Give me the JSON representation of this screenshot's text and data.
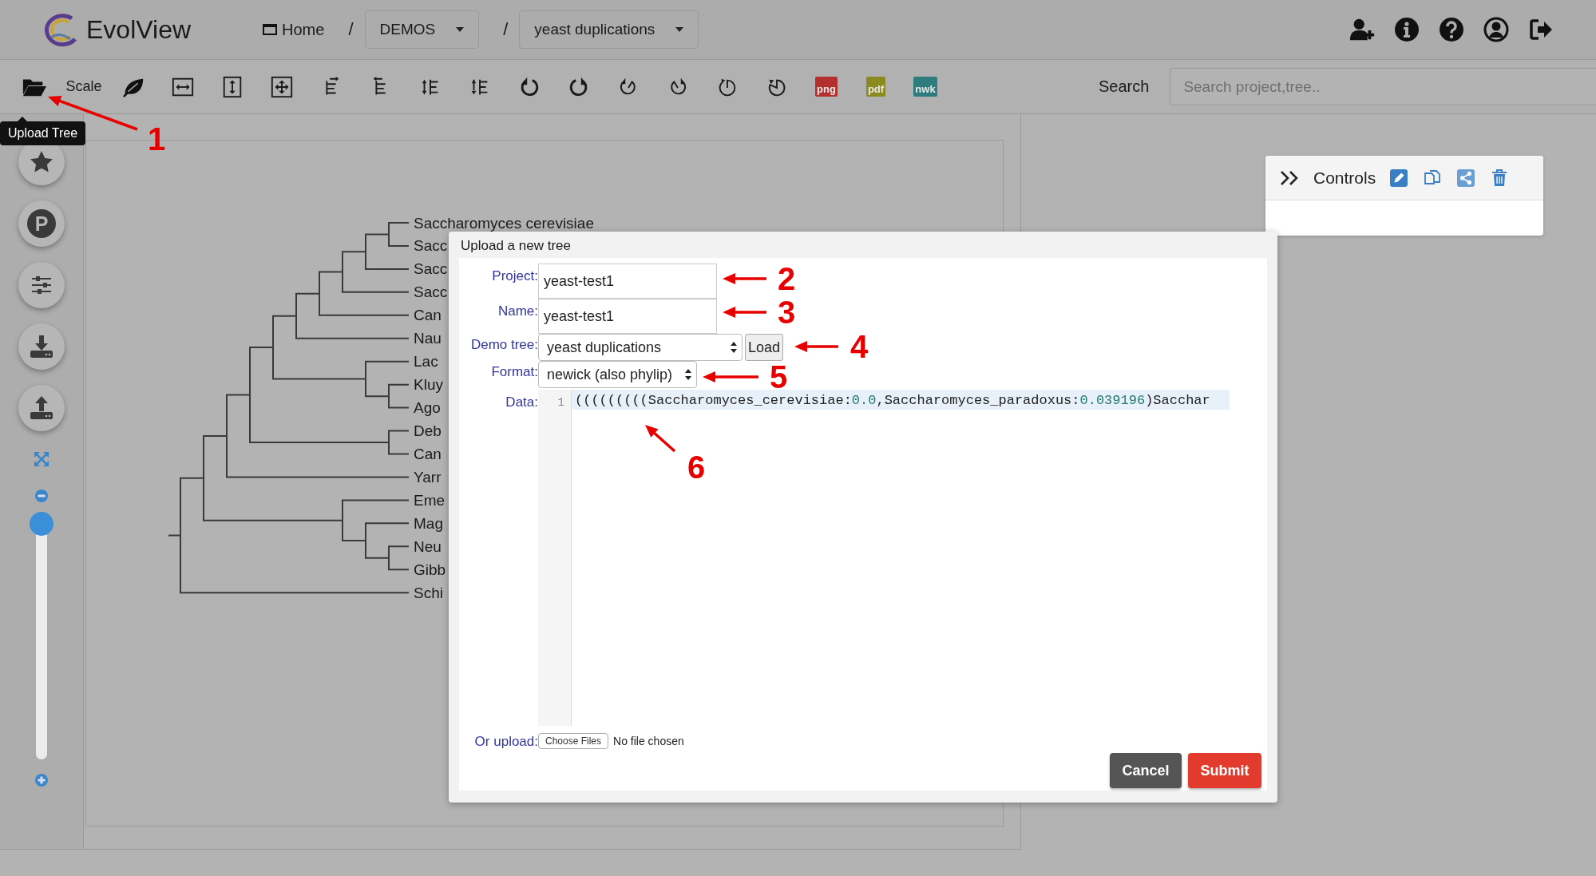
{
  "app": {
    "title": "EvolView"
  },
  "breadcrumb": [
    {
      "kind": "home",
      "label": "Home"
    },
    {
      "kind": "separator",
      "label": "/"
    },
    {
      "kind": "dropdown",
      "label": "DEMOS"
    },
    {
      "kind": "separator",
      "label": "/"
    },
    {
      "kind": "dropdown",
      "label": "yeast duplications"
    }
  ],
  "toolbar": {
    "scale_label": "Scale",
    "export_buttons": [
      {
        "label": "png",
        "color": "#b3302e"
      },
      {
        "label": "pdf",
        "color": "#8a8a1e"
      },
      {
        "label": "nwk",
        "color": "#2e7c7e"
      }
    ],
    "search_label": "Search",
    "search_placeholder": "Search project,tree.."
  },
  "tooltip": {
    "text": "Upload Tree"
  },
  "sidebar": {
    "badge_letter": "P",
    "zoom_slider": {
      "level": 0
    }
  },
  "tree": {
    "children": [
      {
        "children": [
          {
            "children": [
              {
                "children": [
                  {
                    "children": [
                      {
                        "children": [
                          {
                            "children": [
                              {
                                "children": [
                                  {
                                    "children": [
                                      {
                                        "children": [
                                          {
                                            "label": "Saccharomyces cerevisiae"
                                          },
                                          {
                                            "label": "Sacc"
                                          }
                                        ]
                                      },
                                      {
                                        "label": "Sacc"
                                      }
                                    ]
                                  },
                                  {
                                    "label": "Sacc"
                                  }
                                ]
                              },
                              {
                                "label": "Can"
                              }
                            ]
                          },
                          {
                            "label": "Nau"
                          }
                        ]
                      },
                      {
                        "children": [
                          {
                            "label": "Lac"
                          },
                          {
                            "children": [
                              {
                                "label": "Kluy"
                              },
                              {
                                "label": "Ago"
                              }
                            ]
                          }
                        ]
                      }
                    ]
                  },
                  {
                    "children": [
                      {
                        "label": "Deb"
                      },
                      {
                        "label": "Can"
                      }
                    ]
                  }
                ]
              },
              {
                "label": "Yarr"
              }
            ]
          },
          {
            "children": [
              {
                "label": "Eme"
              },
              {
                "children": [
                  {
                    "label": "Mag"
                  },
                  {
                    "children": [
                      {
                        "label": "Neu"
                      },
                      {
                        "label": "Gibb"
                      }
                    ]
                  }
                ]
              }
            ]
          }
        ]
      },
      {
        "label": "Schi"
      }
    ]
  },
  "dialog": {
    "title": "Upload a new tree",
    "fields": [
      {
        "kind": "text",
        "label": "Project:",
        "value": "yeast-test1"
      },
      {
        "kind": "text",
        "label": "Name:",
        "value": "yeast-test1"
      },
      {
        "kind": "select",
        "label": "Demo tree:",
        "value": "yeast duplications",
        "button": "Load"
      },
      {
        "kind": "select",
        "label": "Format:",
        "value": "newick (also phylip)"
      },
      {
        "kind": "code",
        "label": "Data:",
        "line_number": "1",
        "segments": [
          {
            "kind": "plain",
            "text": "(((((((((Saccharomyces_cerevisiae:"
          },
          {
            "kind": "number",
            "text": "0.0"
          },
          {
            "kind": "plain",
            "text": ",Saccharomyces_paradoxus:"
          },
          {
            "kind": "number",
            "text": "0.039196"
          },
          {
            "kind": "plain",
            "text": ")Sacchar"
          }
        ]
      },
      {
        "kind": "file",
        "label": "Or upload:",
        "button": "Choose Files",
        "status": "No file chosen"
      }
    ],
    "buttons": [
      {
        "kind": "secondary",
        "label": "Cancel"
      },
      {
        "kind": "primary",
        "label": "Submit"
      }
    ]
  },
  "controls_panel": {
    "title": "Controls"
  },
  "annotations": [
    {
      "text": "1"
    },
    {
      "text": "2"
    },
    {
      "text": "3"
    },
    {
      "text": "4"
    },
    {
      "text": "5"
    },
    {
      "text": "6"
    }
  ]
}
